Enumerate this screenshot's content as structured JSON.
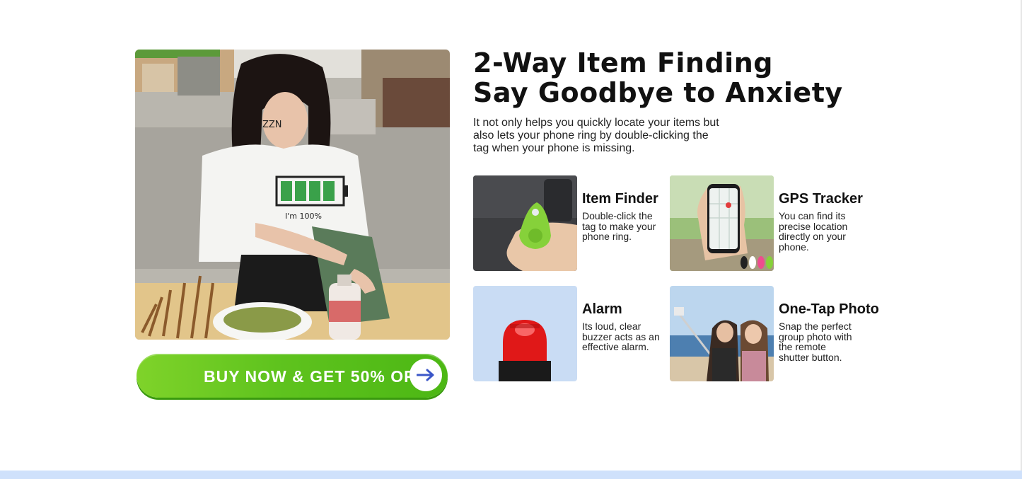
{
  "hero": {
    "shirt_text": "ZZN",
    "battery_text": "I'm 100%"
  },
  "cta": {
    "label": "BUY NOW & GET 50% OFF",
    "color": "#5fc31e"
  },
  "heading": {
    "line1": "2-Way Item Finding",
    "line2": "Say Goodbye to Anxiety"
  },
  "intro": "It not only helps you quickly locate your items but also lets your phone ring by double-clicking the tag when your phone is missing.",
  "features": [
    {
      "title": "Item Finder",
      "description": "Double-click the tag to make your phone ring.",
      "icon": "green-tag-in-hand-icon"
    },
    {
      "title": "GPS Tracker",
      "description": "You can find its precise location directly on your phone.",
      "icon": "phone-map-icon"
    },
    {
      "title": "Alarm",
      "description": "Its loud, clear buzzer acts as an effective alarm.",
      "icon": "red-siren-icon"
    },
    {
      "title": "One-Tap Photo",
      "description": "Snap the perfect group photo with the remote shutter button.",
      "icon": "selfie-stick-icon"
    }
  ],
  "colors": {
    "accent_green": "#5fc31e",
    "bottom_band": "#cfe1fb",
    "alarm_bg": "#c9dcf4"
  }
}
